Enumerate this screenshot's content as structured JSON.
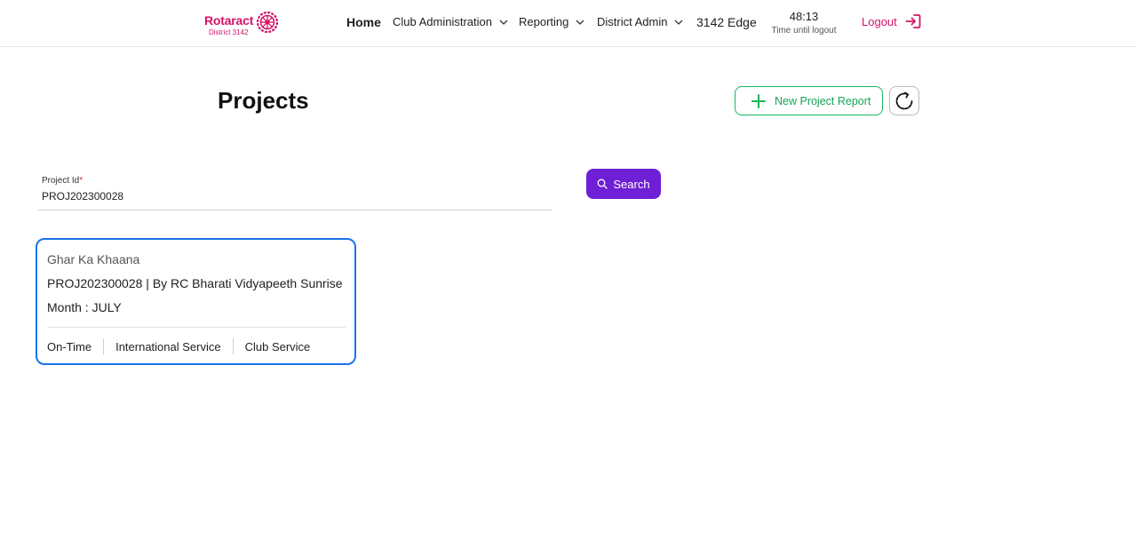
{
  "brand": {
    "name": "Rotaract",
    "subtitle": "District 3142",
    "color": "#d41367",
    "logo_icon": "rotary-wheel-icon"
  },
  "nav": {
    "home": "Home",
    "club_admin": "Club Administration",
    "reporting": "Reporting",
    "district_admin": "District Admin",
    "edge": "3142 Edge"
  },
  "timer": {
    "value": "48:13",
    "label": "Time until logout"
  },
  "logout": {
    "label": "Logout",
    "icon": "logout-icon"
  },
  "page": {
    "title": "Projects"
  },
  "actions": {
    "new_project": "New Project Report",
    "refresh_icon": "refresh-icon"
  },
  "search": {
    "label": "Project Id",
    "required_mark": "*",
    "value": "PROJ202300028",
    "button": "Search"
  },
  "results": [
    {
      "title": "Ghar Ka Khaana",
      "id_line": "PROJ202300028 | By RC Bharati Vidyapeeth Sunrise",
      "month": "Month : JULY",
      "tags": [
        "On-Time",
        "International Service",
        "Club Service"
      ]
    }
  ],
  "colors": {
    "accent_green": "#17b55a",
    "search_purple": "#6f1fd6",
    "card_border": "#1a73e8"
  }
}
